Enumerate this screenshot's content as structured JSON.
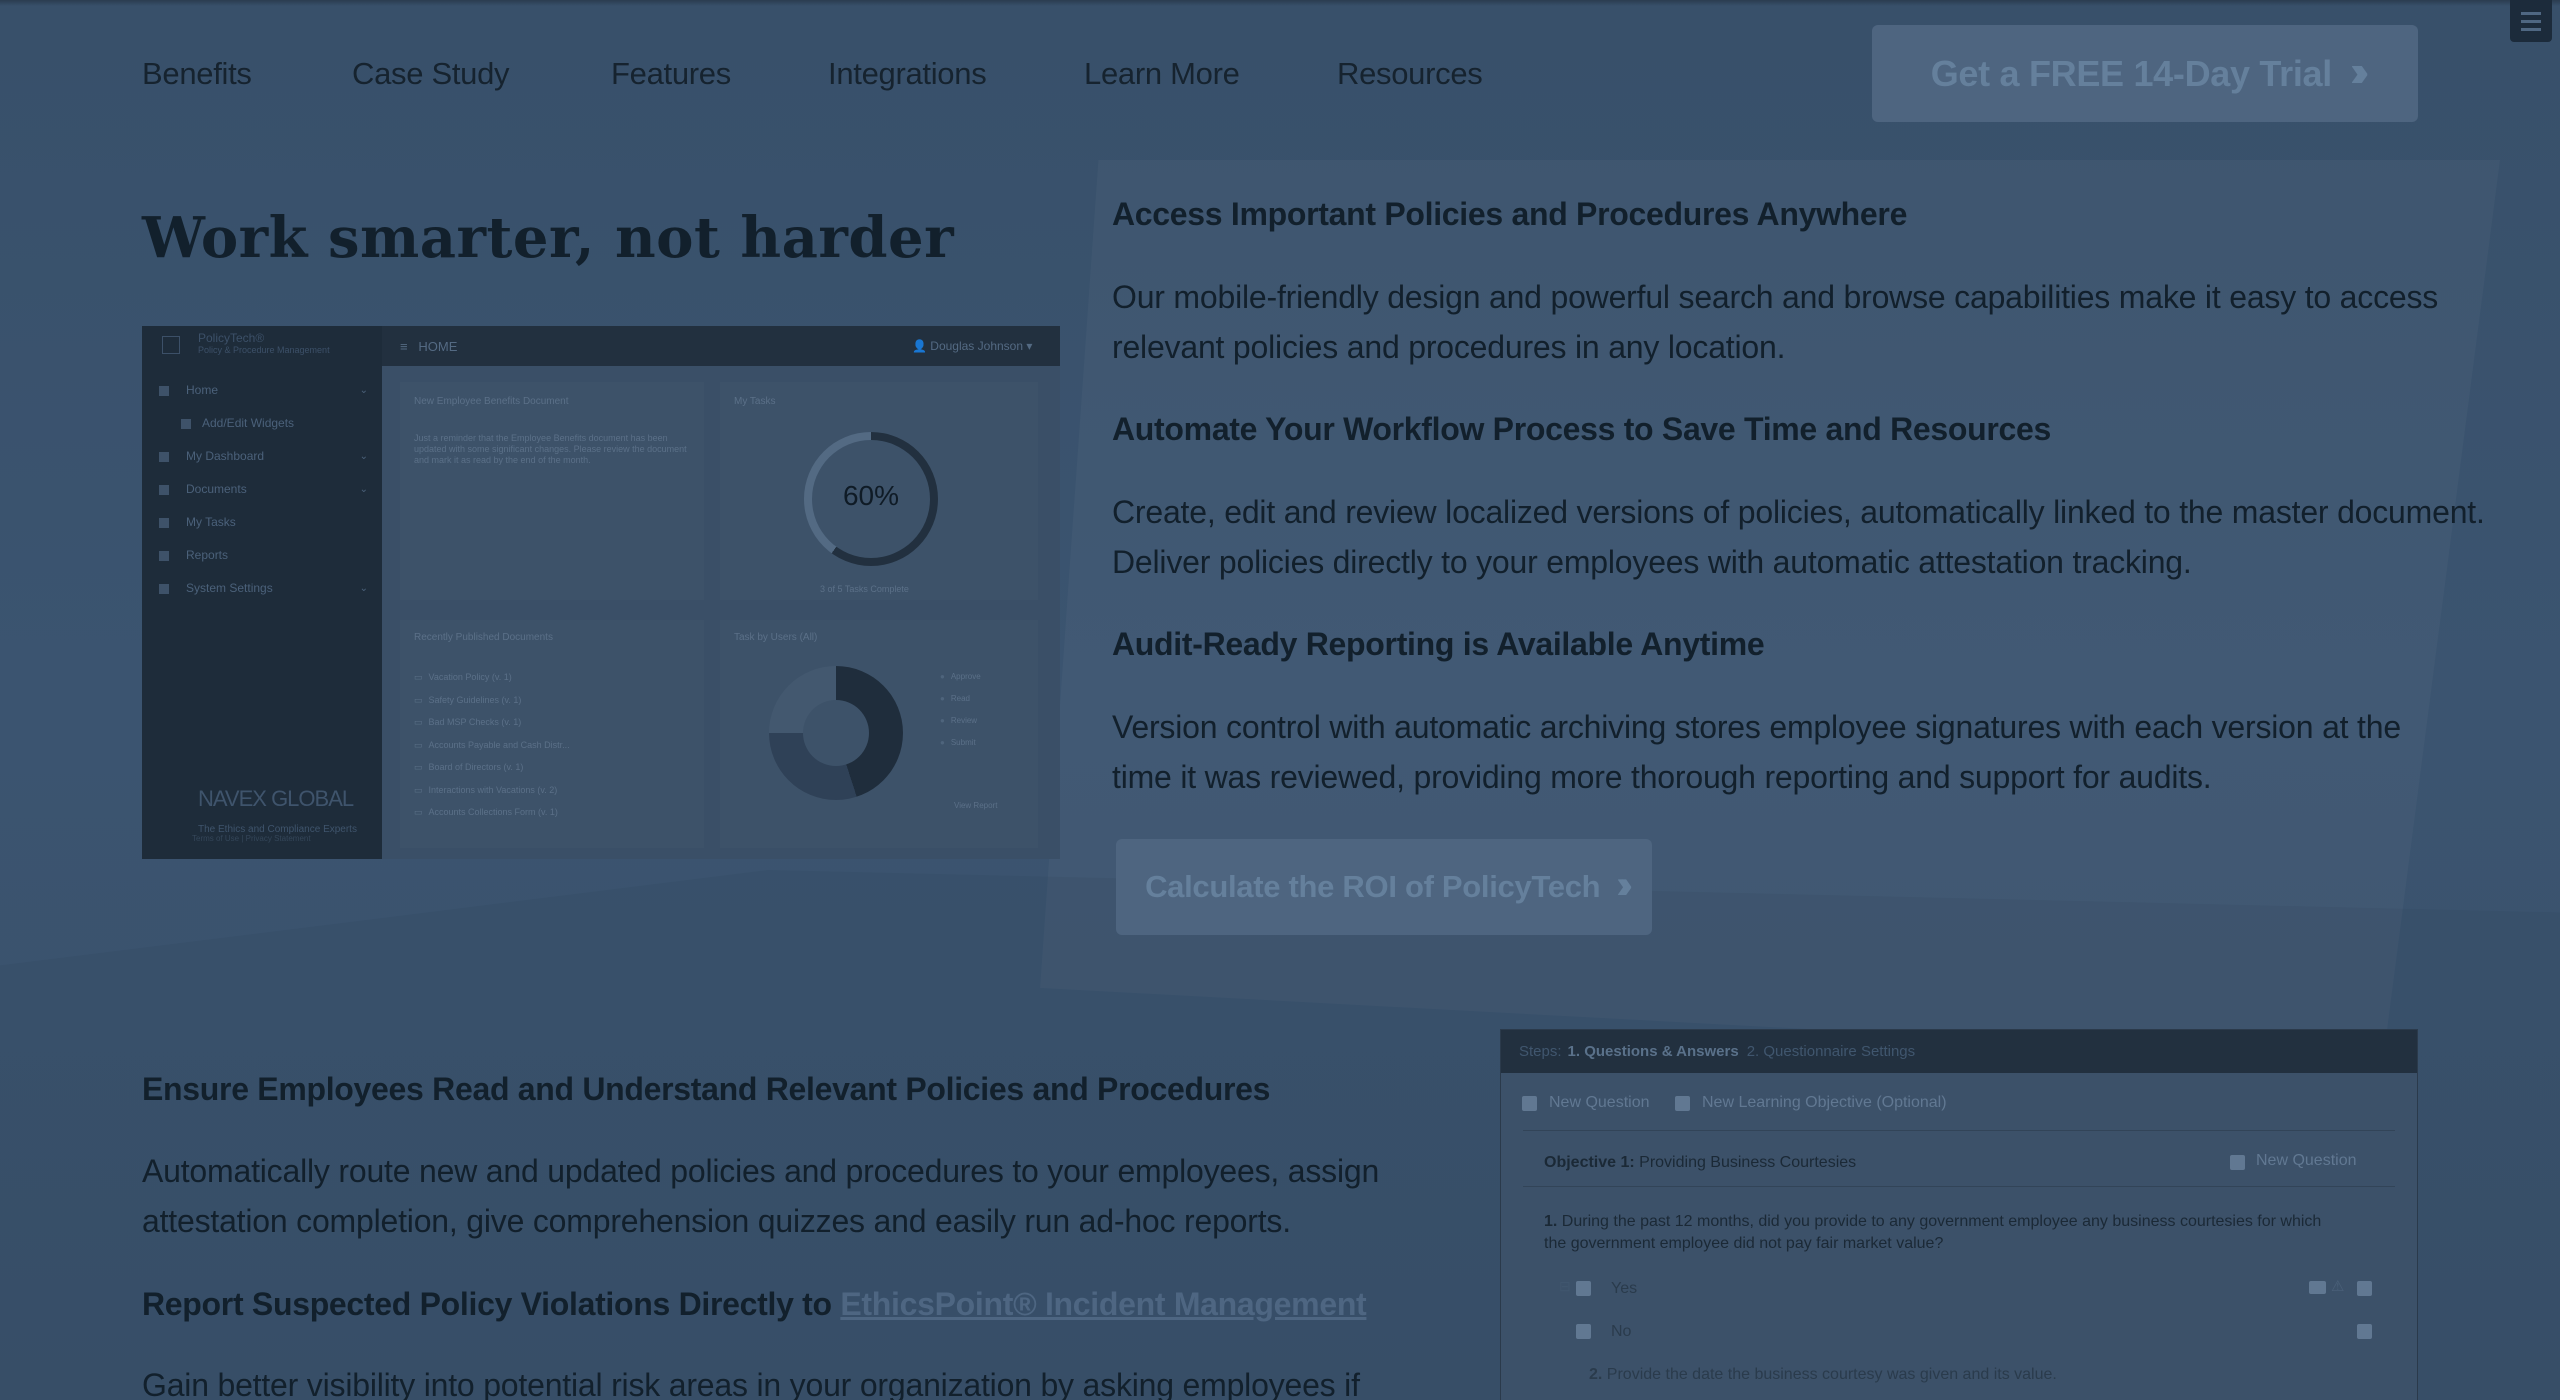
{
  "nav": {
    "items": [
      "Benefits",
      "Case Study",
      "Features",
      "Integrations",
      "Learn More",
      "Resources"
    ],
    "cta_label": "Get a FREE 14-Day Trial",
    "cta_icon": "double-chevron-right-icon"
  },
  "hero": {
    "title": "Work smarter, not harder",
    "screenshot": {
      "brand_line1": "PolicyTech®",
      "brand_line2": "Policy & Procedure Management",
      "header_title": "HOME",
      "user": "Douglas Johnson",
      "sidebar": [
        "Home",
        "Add/Edit Widgets",
        "My Dashboard",
        "Documents",
        "My Tasks",
        "Reports",
        "System Settings"
      ],
      "panel1_title": "New Employee Benefits Document",
      "panel1_text": "Just a reminder that the Employee Benefits document has been updated with some significant changes. Please review the document and mark it as read by the end of the month.",
      "panel2_title": "My Tasks",
      "progress_percent": "60%",
      "progress_fraction": 0.6,
      "panel2_caption": "3 of 5 Tasks Complete",
      "panel3_title": "Recently Published Documents",
      "recent_docs": [
        "Vacation Policy (v. 1)",
        "Safety Guidelines (v. 1)",
        "Bad MSP Checks (v. 1)",
        "Accounts Payable and Cash Distr...",
        "Board of Directors (v. 1)",
        "Interactions with Vacations (v. 2)",
        "Accounts Collections Form (v. 1)"
      ],
      "panel4_title": "Task by Users (All)",
      "legend": [
        "Approve",
        "Read",
        "Review",
        "Submit"
      ],
      "view_report": "View Report",
      "navex_logo": "NAVEX GLOBAL",
      "navex_tagline": "The Ethics and Compliance Experts",
      "footer": "Terms of Use | Privacy Statement"
    }
  },
  "features": [
    {
      "heading": "Access Important Policies and Procedures Anywhere",
      "text": "Our mobile-friendly design and powerful search and browse capabilities make it easy to access relevant policies and procedures in any location."
    },
    {
      "heading": "Automate Your Workflow Process to Save Time and Resources",
      "text": "Create, edit and review localized versions of policies, automatically linked to the master document. Deliver policies directly to your employees with automatic attestation tracking."
    },
    {
      "heading": "Audit-Ready Reporting is Available Anytime",
      "text": "Version control with automatic archiving stores employee signatures with each version at the time it was reviewed, providing more thorough reporting and support for audits."
    }
  ],
  "roi_cta": "Calculate the ROI of PolicyTech",
  "section2": {
    "heading1": "Ensure Employees Read and Understand Relevant Policies and Procedures",
    "text1": "Automatically route new and updated policies and procedures to your employees, assign attestation completion, give comprehension quizzes and easily run ad-hoc reports.",
    "heading2_prefix": "Report Suspected Policy Violations Directly to ",
    "heading2_link": "EthicsPoint® Incident Management",
    "text2": "Gain better visibility into potential risk areas in your organization by asking employees if"
  },
  "quiz": {
    "steps_label": "Steps:",
    "step1": "1. Questions & Answers",
    "step2": "2. Questionnaire Settings",
    "new_question": "New Question",
    "new_objective": "New Learning Objective (Optional)",
    "objective_label": "Objective 1:",
    "objective_name": "Providing Business Courtesies",
    "objective_new_question": "New Question",
    "q1_number": "1.",
    "q1_text": "During the past 12 months, did you provide to any government employee any business courtesies for which the government employee did not pay fair market value?",
    "answer_yes": "Yes",
    "answer_no": "No",
    "q2_number": "2.",
    "q2_text": "Provide the date the business courtesy was given and its value."
  }
}
